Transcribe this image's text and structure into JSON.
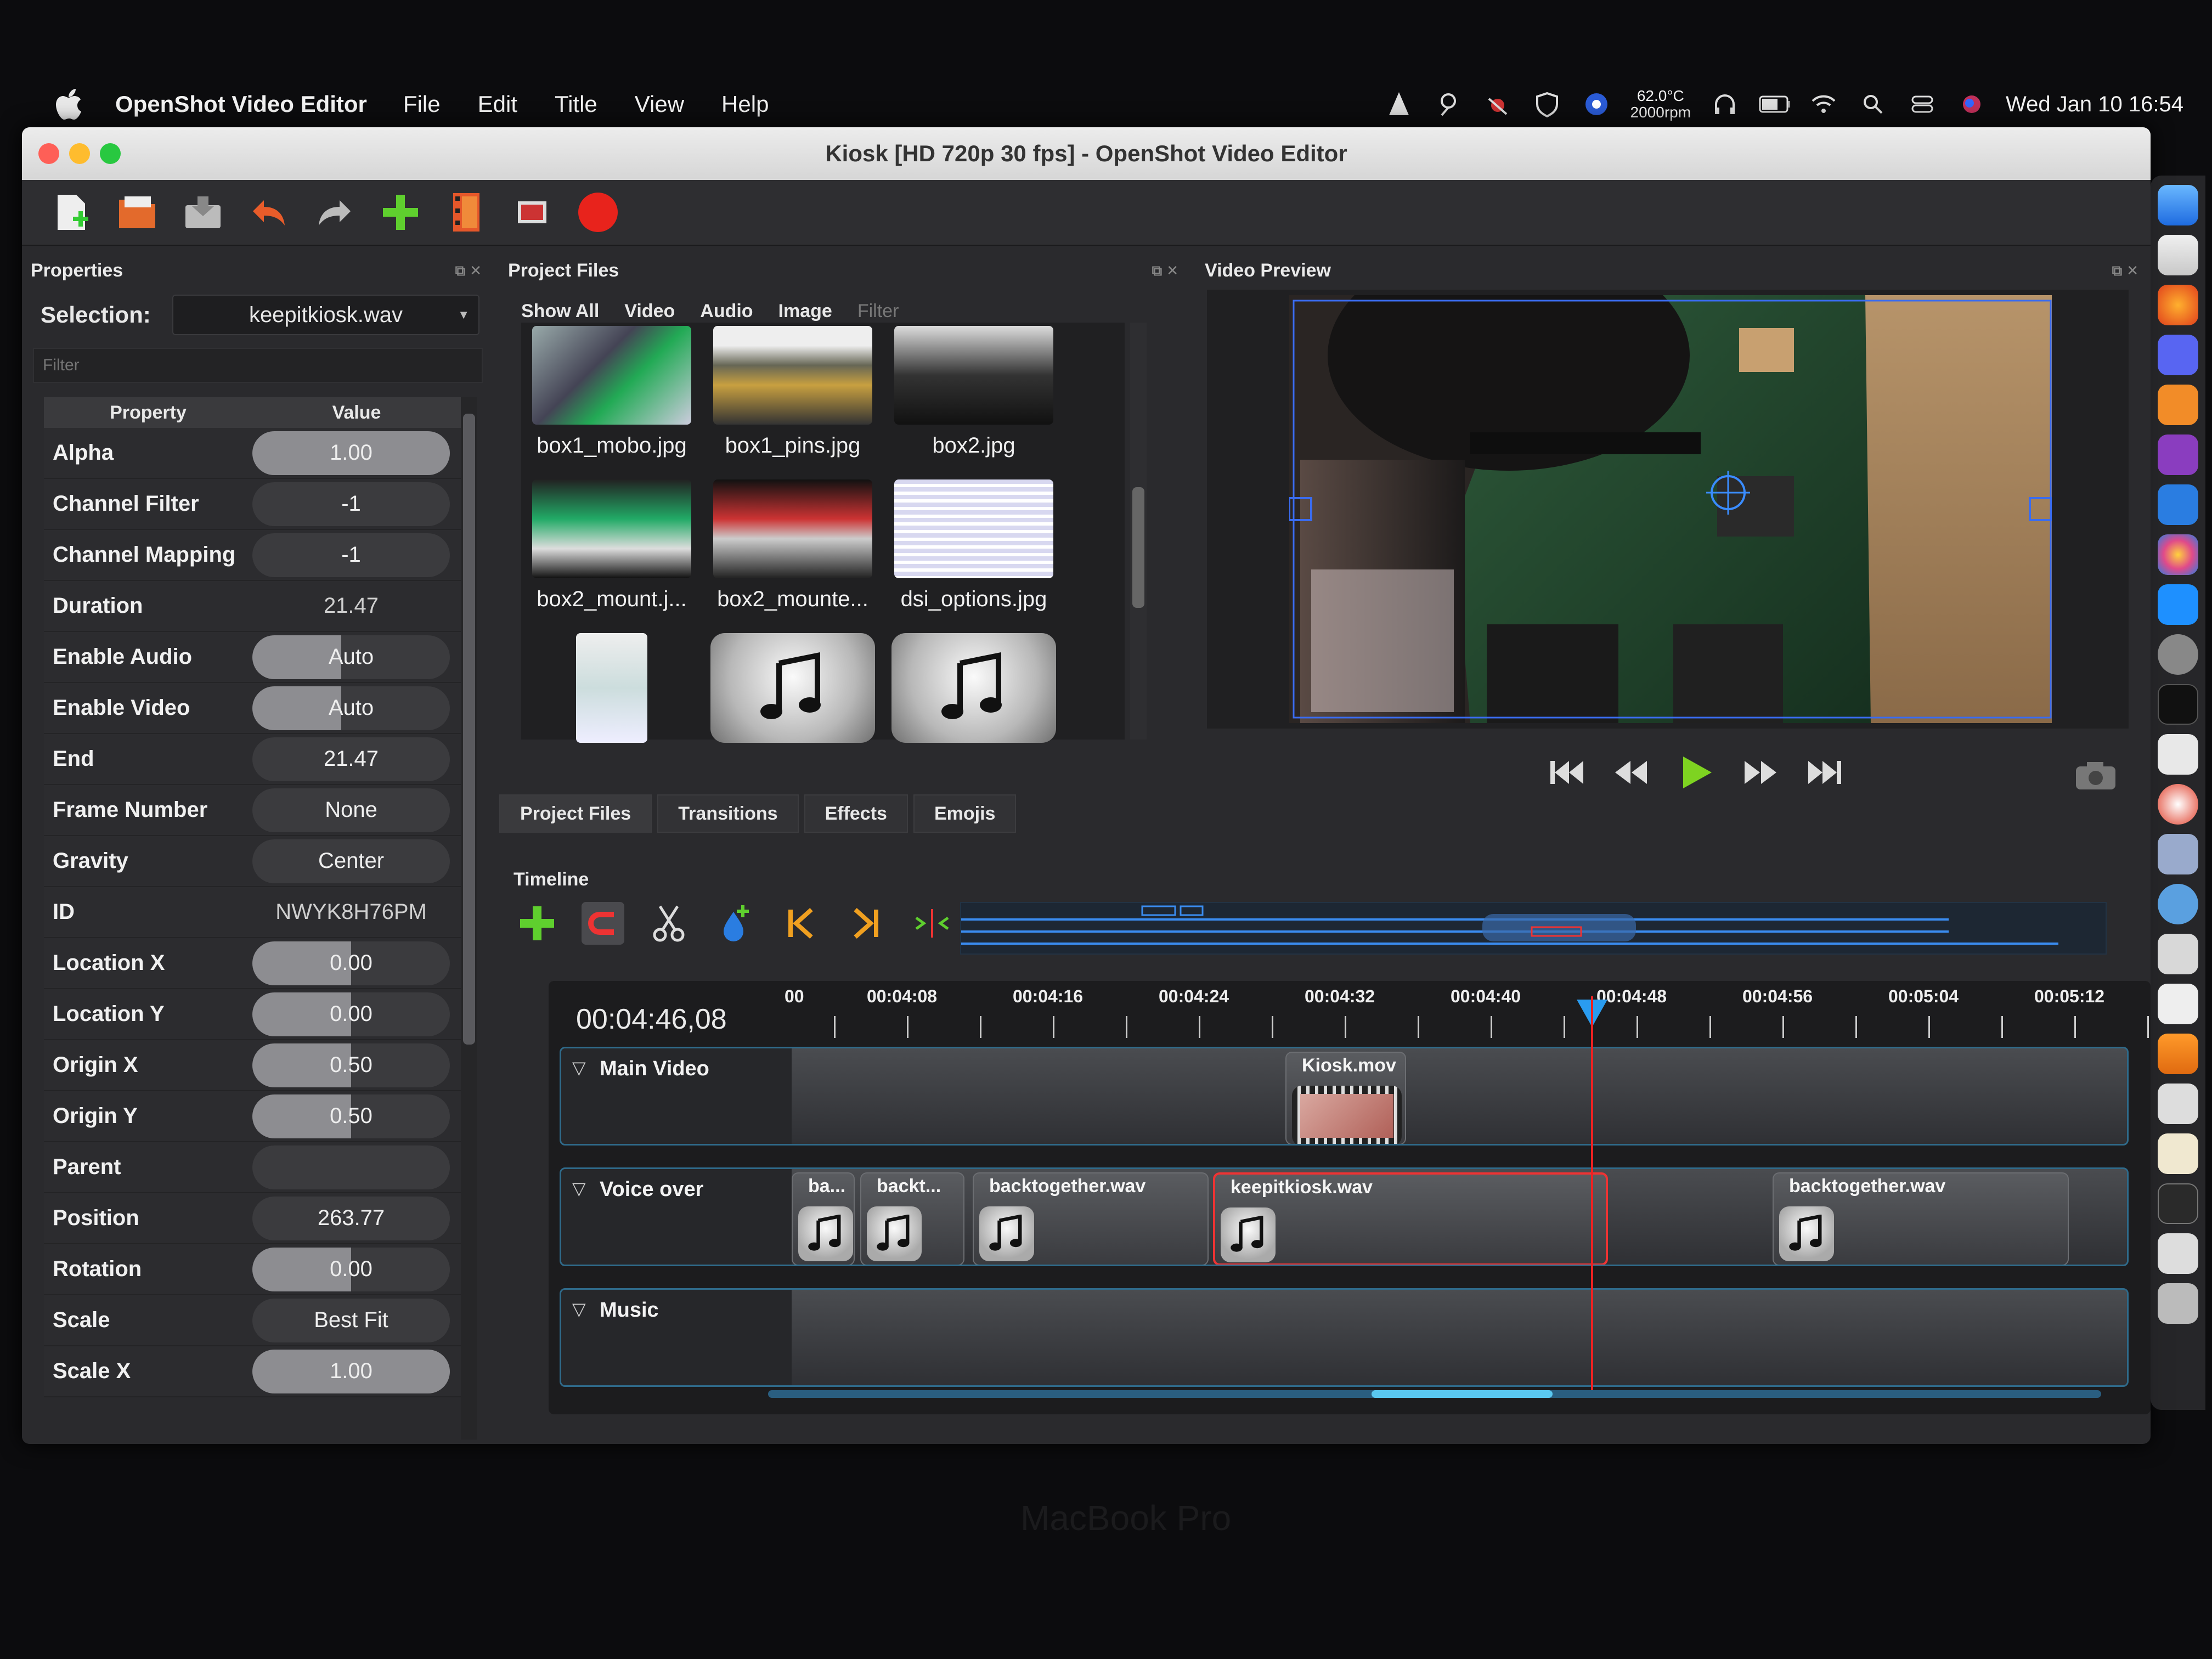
{
  "menubar": {
    "app_name": "OpenShot Video Editor",
    "menus": [
      "File",
      "Edit",
      "Title",
      "View",
      "Help"
    ],
    "temperature": "62.0°C",
    "fan": "2000rpm",
    "clock": "Wed Jan 10  16:54"
  },
  "window": {
    "title": "Kiosk [HD 720p 30 fps] - OpenShot Video Editor"
  },
  "properties": {
    "title": "Properties",
    "selection_label": "Selection:",
    "selection_value": "keepitkiosk.wav",
    "filter_placeholder": "Filter",
    "col_property": "Property",
    "col_value": "Value",
    "rows": [
      {
        "name": "Alpha",
        "value": "1.00",
        "kind": "slider",
        "fill": 1.0
      },
      {
        "name": "Channel Filter",
        "value": "-1",
        "kind": "pill",
        "fill": 0
      },
      {
        "name": "Channel Mapping",
        "value": "-1",
        "kind": "pill",
        "fill": 0
      },
      {
        "name": "Duration",
        "value": "21.47",
        "kind": "plain",
        "fill": 0
      },
      {
        "name": "Enable Audio",
        "value": "Auto",
        "kind": "slider",
        "fill": 0.45
      },
      {
        "name": "Enable Video",
        "value": "Auto",
        "kind": "slider",
        "fill": 0.45
      },
      {
        "name": "End",
        "value": "21.47",
        "kind": "pill",
        "fill": 0
      },
      {
        "name": "Frame Number",
        "value": "None",
        "kind": "pill",
        "fill": 0
      },
      {
        "name": "Gravity",
        "value": "Center",
        "kind": "pill",
        "fill": 0
      },
      {
        "name": "ID",
        "value": "NWYK8H76PM",
        "kind": "plain",
        "fill": 0
      },
      {
        "name": "Location X",
        "value": "0.00",
        "kind": "slider",
        "fill": 0.5
      },
      {
        "name": "Location Y",
        "value": "0.00",
        "kind": "slider",
        "fill": 0.5
      },
      {
        "name": "Origin X",
        "value": "0.50",
        "kind": "slider",
        "fill": 0.5
      },
      {
        "name": "Origin Y",
        "value": "0.50",
        "kind": "slider",
        "fill": 0.5
      },
      {
        "name": "Parent",
        "value": "",
        "kind": "pill",
        "fill": 0
      },
      {
        "name": "Position",
        "value": "263.77",
        "kind": "pill",
        "fill": 0
      },
      {
        "name": "Rotation",
        "value": "0.00",
        "kind": "slider",
        "fill": 0.5
      },
      {
        "name": "Scale",
        "value": "Best Fit",
        "kind": "pill",
        "fill": 0
      },
      {
        "name": "Scale X",
        "value": "1.00",
        "kind": "slider",
        "fill": 1.0
      }
    ]
  },
  "project_files": {
    "title": "Project Files",
    "filters": [
      "Show All",
      "Video",
      "Audio",
      "Image"
    ],
    "filter_placeholder": "Filter",
    "files": [
      {
        "name": "box1_mobo.jpg",
        "type": "image"
      },
      {
        "name": "box1_pins.jpg",
        "type": "image"
      },
      {
        "name": "box2.jpg",
        "type": "image"
      },
      {
        "name": "box2_mount.j...",
        "type": "image"
      },
      {
        "name": "box2_mounte...",
        "type": "image"
      },
      {
        "name": "dsi_options.jpg",
        "type": "image"
      },
      {
        "name": "",
        "type": "image"
      },
      {
        "name": "",
        "type": "audio"
      },
      {
        "name": "",
        "type": "audio"
      }
    ],
    "tabs": [
      "Project Files",
      "Transitions",
      "Effects",
      "Emojis"
    ]
  },
  "preview": {
    "title": "Video Preview"
  },
  "timeline": {
    "title": "Timeline",
    "current_time": "00:04:46,08",
    "ticks": [
      "00:04:08",
      "00:04:16",
      "00:04:24",
      "00:04:32",
      "00:04:40",
      "00:04:48",
      "00:04:56",
      "00:05:04",
      "00:05:12"
    ],
    "first_tick_partial": "00",
    "tracks": [
      {
        "name": "Main Video",
        "clips": [
          {
            "label": "Kiosk.mov"
          }
        ]
      },
      {
        "name": "Voice over",
        "clips": [
          {
            "label": "ba..."
          },
          {
            "label": "backt..."
          },
          {
            "label": "backtogether.wav"
          },
          {
            "label": "keepitkiosk.wav"
          },
          {
            "label": "backtogether.wav"
          }
        ]
      },
      {
        "name": "Music",
        "clips": []
      }
    ]
  },
  "bezel": {
    "label": "MacBook Pro"
  }
}
